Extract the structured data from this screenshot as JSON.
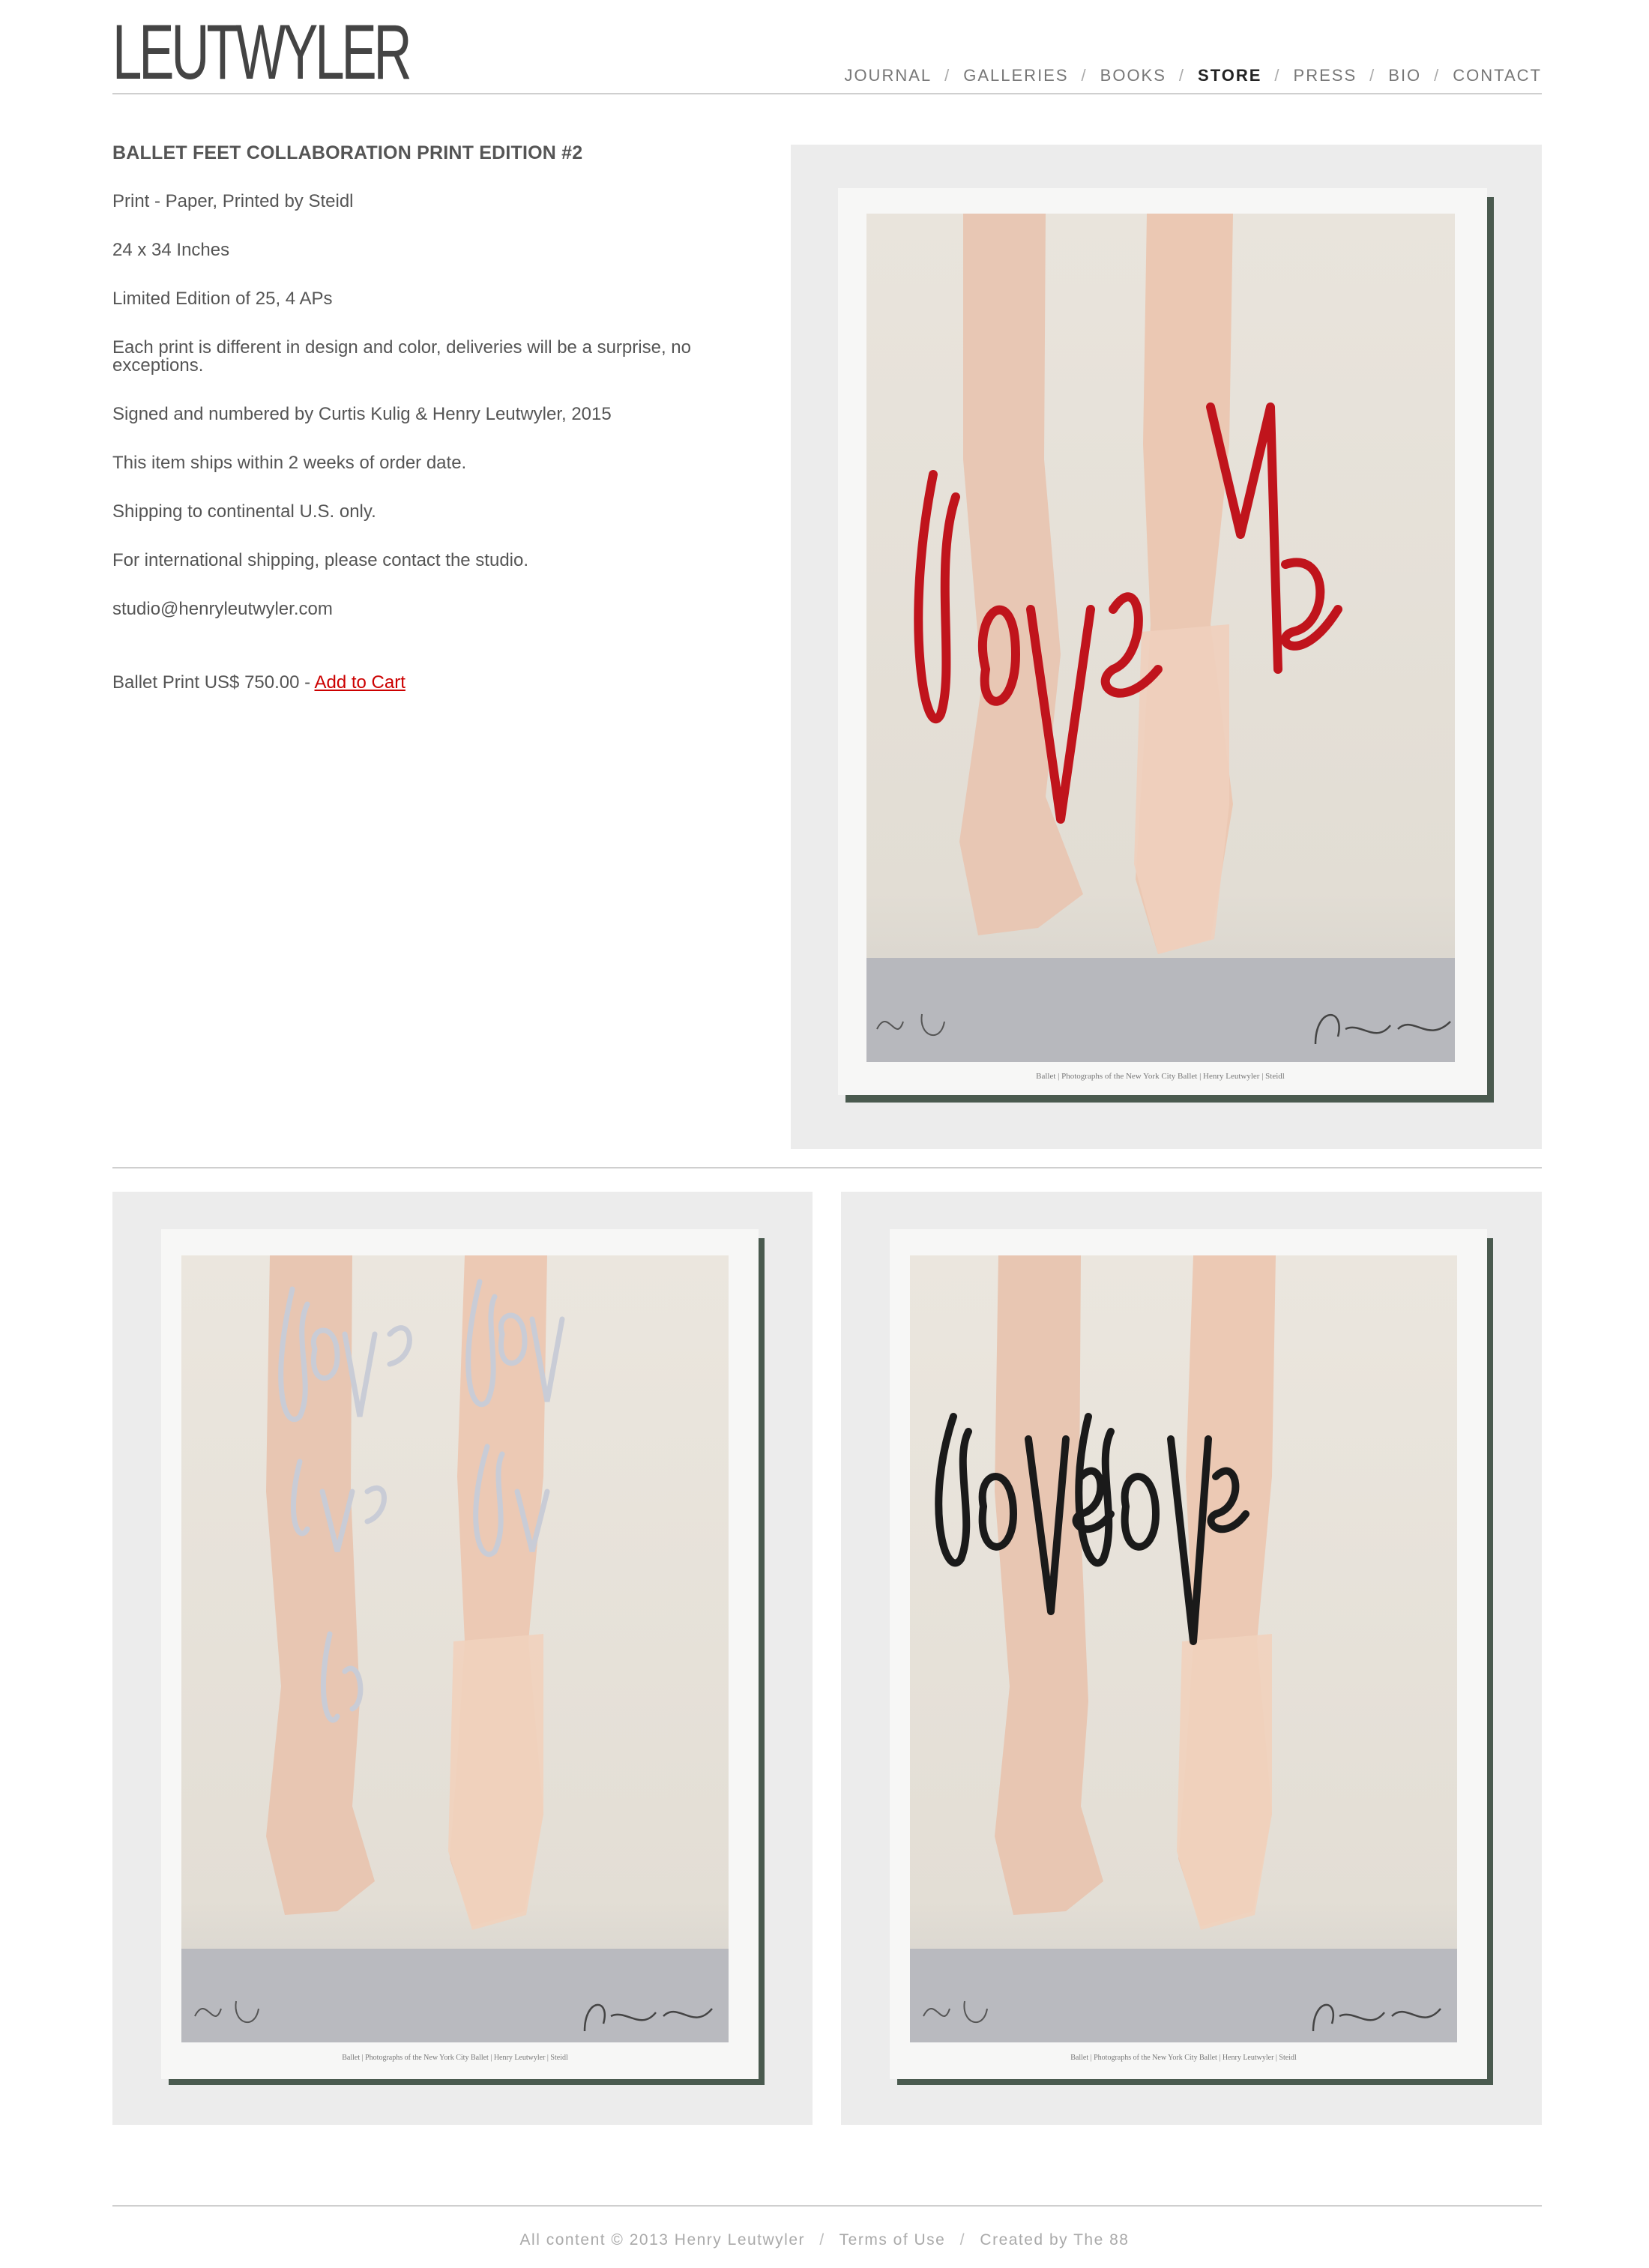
{
  "header": {
    "logo": "LEUTWYLER",
    "nav": [
      {
        "label": "JOURNAL"
      },
      {
        "label": "GALLERIES"
      },
      {
        "label": "BOOKS"
      },
      {
        "label": "STORE",
        "active": true
      },
      {
        "label": "PRESS"
      },
      {
        "label": "BIO"
      },
      {
        "label": "CONTACT"
      }
    ],
    "nav_separator": "/"
  },
  "product": {
    "title": "BALLET FEET COLLABORATION PRINT EDITION #2",
    "lines": [
      "Print - Paper, Printed by Steidl",
      "24 x 34 Inches",
      "Limited Edition of 25, 4 APs",
      "Each print is different in design and color, deliveries will be a surprise, no exceptions.",
      "Signed and numbered by Curtis Kulig & Henry Leutwyler, 2015",
      "This item ships within 2 weeks of order date.",
      "Shipping to continental U.S. only.",
      "For international shipping, please contact the studio.",
      "studio@henryleutwyler.com"
    ],
    "price_text": "Ballet Print US$ 750.00 - ",
    "add_to_cart": "Add to Cart"
  },
  "images": [
    {
      "name": "ballet-print-red",
      "graffiti_color": "#c0141c",
      "caption": "Ballet | Photographs of the New York City Ballet | Henry Leutwyler | Steidl",
      "graffiti": "love me"
    },
    {
      "name": "ballet-print-silver",
      "graffiti_color": "#c9ccd6",
      "caption": "Ballet | Photographs of the New York City Ballet | Henry Leutwyler | Steidl",
      "graffiti": "love love"
    },
    {
      "name": "ballet-print-black",
      "graffiti_color": "#1a1a1a",
      "caption": "Ballet | Photographs of the New York City Ballet | Henry Leutwyler | Steidl",
      "graffiti": "love love"
    }
  ],
  "footer": {
    "copyright": "All content © 2013 Henry Leutwyler",
    "terms": "Terms of Use",
    "credit": "Created by The 88",
    "separator": "/"
  },
  "colors": {
    "accent_link": "#cc0000",
    "text": "#555555",
    "rule": "#cfcfcf"
  }
}
